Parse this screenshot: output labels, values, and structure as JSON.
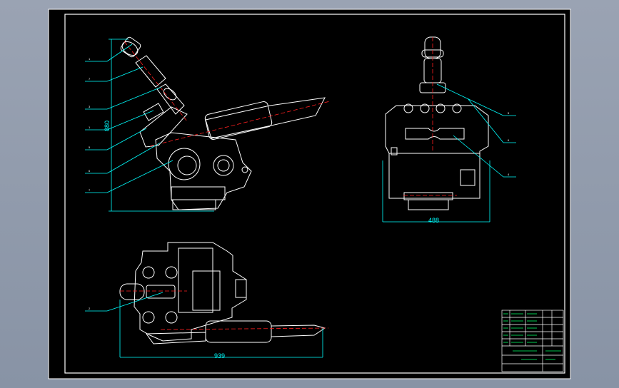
{
  "drawing": {
    "dimensions": {
      "side_height": "880",
      "right_width": "488",
      "bottom_width": "939"
    },
    "callouts_left": [
      "1",
      "7",
      "3",
      "1",
      "5",
      "6",
      "7"
    ],
    "callouts_right": [
      "5",
      "6",
      "4"
    ],
    "callout_bottom": "2",
    "title_block": {
      "part_name": "",
      "drawing_no": ""
    }
  },
  "colors": {
    "paper": "#000000",
    "line": "#ffffff",
    "dimension": "#00ffff",
    "centerline": "#ff2020",
    "title": "#00ff66"
  }
}
